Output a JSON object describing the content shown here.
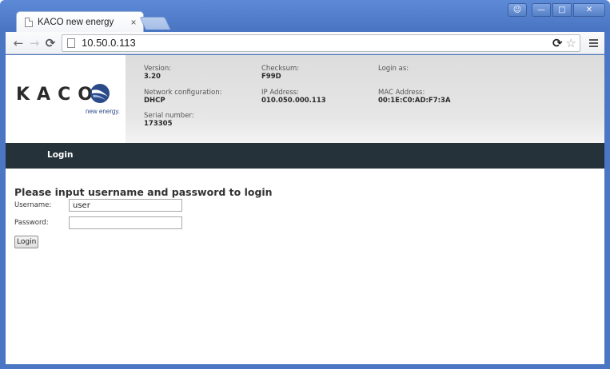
{
  "browser": {
    "tab_title": "KACO new energy",
    "tab_close": "×",
    "url": "10.50.0.113"
  },
  "logo": {
    "text": "KACO",
    "tagline": "new energy."
  },
  "info": {
    "version_label": "Version:",
    "version_value": "3.20",
    "checksum_label": "Checksum:",
    "checksum_value": "F99D",
    "login_as_label": "Login as:",
    "login_as_value": "",
    "network_label": "Network configuration:",
    "network_value": "DHCP",
    "ip_label": "IP Address:",
    "ip_value": "010.050.000.113",
    "mac_label": "MAC Address:",
    "mac_value": "00:1E:C0:AD:F7:3A",
    "serial_label": "Serial number:",
    "serial_value": "173305"
  },
  "nav": {
    "login_label": "Login"
  },
  "form": {
    "title": "Please input username and password to login",
    "username_label": "Username:",
    "username_value": "user",
    "password_label": "Password:",
    "password_value": "",
    "submit_label": "Login"
  },
  "colors": {
    "navbar": "#25323a",
    "logo_blue": "#2b4a8a"
  }
}
